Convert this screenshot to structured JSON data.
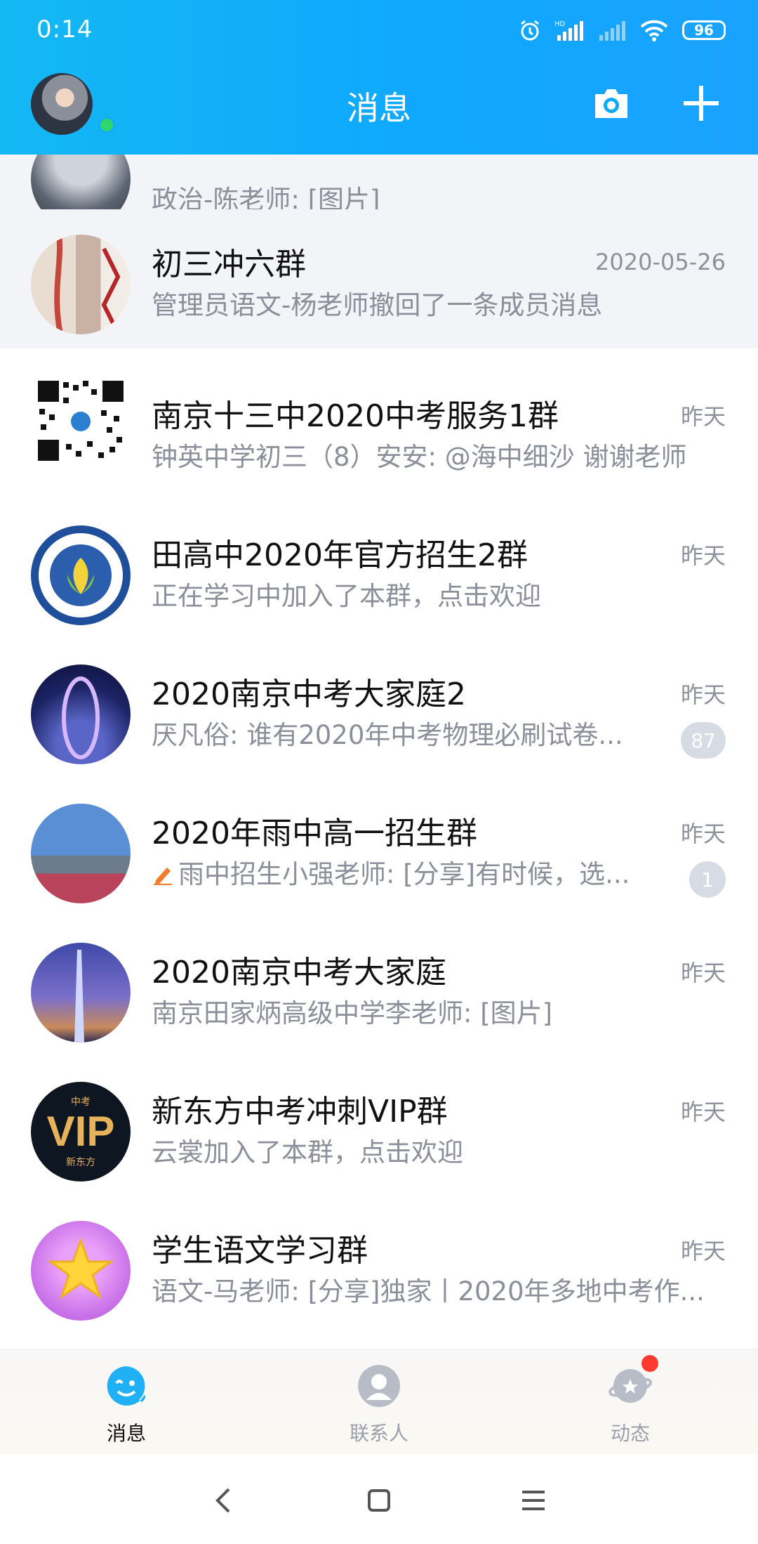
{
  "status_bar": {
    "time": "0:14",
    "battery": "96"
  },
  "header": {
    "title": "消息"
  },
  "colors": {
    "header": "#0fa8ff",
    "online": "#2fd66e",
    "badge": "#d7dbe4",
    "notification": "#ff3b30"
  },
  "conversations": [
    {
      "name": "",
      "preview": "政治-陈老师: [图片]",
      "time": "",
      "badge": "",
      "pinned": true
    },
    {
      "name": "初三冲六群",
      "preview": "管理员语文-杨老师撤回了一条成员消息",
      "time": "2020-05-26",
      "badge": "",
      "pinned": true
    },
    {
      "name": "南京十三中2020中考服务1群",
      "preview": "钟英中学初三（8）安安: @海中细沙 谢谢老师",
      "time": "昨天",
      "badge": ""
    },
    {
      "name": "田高中2020年官方招生2群",
      "preview": "正在学习中加入了本群，点击欢迎",
      "time": "昨天",
      "badge": ""
    },
    {
      "name": "2020南京中考大家庭2",
      "preview": "厌凡俗: 谁有2020年中考物理必刷试卷...",
      "time": "昨天",
      "badge": "87"
    },
    {
      "name": "2020年雨中高一招生群",
      "preview": "雨中招生小强老师: [分享]有时候，选...",
      "time": "昨天",
      "badge": "1",
      "draft_icon": "pencil-icon"
    },
    {
      "name": "2020南京中考大家庭",
      "preview": "南京田家炳高级中学李老师: [图片]",
      "time": "昨天",
      "badge": ""
    },
    {
      "name": "新东方中考冲刺VIP群",
      "preview": "云裳加入了本群，点击欢迎",
      "time": "昨天",
      "badge": ""
    },
    {
      "name": "学生语文学习群",
      "preview": "语文-马老师: [分享]独家丨2020年多地中考作...",
      "time": "昨天",
      "badge": ""
    }
  ],
  "avatar_text": {
    "vip_top": "中考",
    "vip": "VIP",
    "vip_bottom": "新东方"
  },
  "tabs": [
    {
      "label": "消息",
      "active": true,
      "icon": "penguin-chat-icon"
    },
    {
      "label": "联系人",
      "active": false,
      "icon": "contact-person-icon"
    },
    {
      "label": "动态",
      "active": false,
      "icon": "planet-icon"
    }
  ]
}
